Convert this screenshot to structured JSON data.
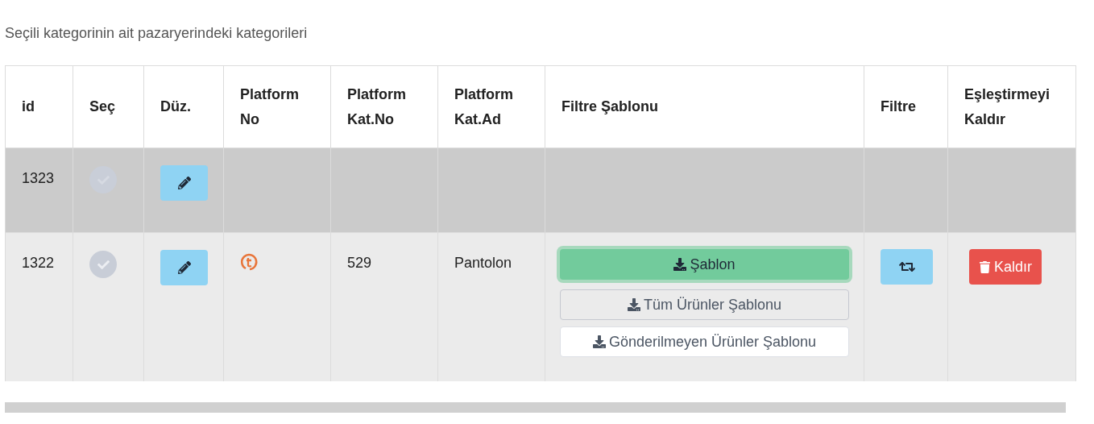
{
  "caption": "Seçili kategorinin ait pazaryerindeki kategorileri",
  "columns": [
    {
      "label": "id"
    },
    {
      "label": "Seç"
    },
    {
      "label": "Düz."
    },
    {
      "label": "Platform No"
    },
    {
      "label": "Platform Kat.No"
    },
    {
      "label": "Platform Kat.Ad"
    },
    {
      "label": "Filtre Şablonu"
    },
    {
      "label": "Filtre"
    },
    {
      "label": "Eşleştirmeyi Kaldır"
    }
  ],
  "rows": [
    {
      "id": "1323",
      "selected": true
    },
    {
      "id": "1322",
      "selected": false,
      "platform_logo": true,
      "category_no": "529",
      "category_name": "Pantolon",
      "templates": [
        {
          "label": "Şablon",
          "kind": "success"
        },
        {
          "label": "Tüm Ürünler Şablonu",
          "kind": "outline"
        },
        {
          "label": "Gönderilmeyen Ürünler Şablonu",
          "kind": "light"
        }
      ],
      "filter_button": true,
      "remove_label": "Kaldır"
    }
  ]
}
